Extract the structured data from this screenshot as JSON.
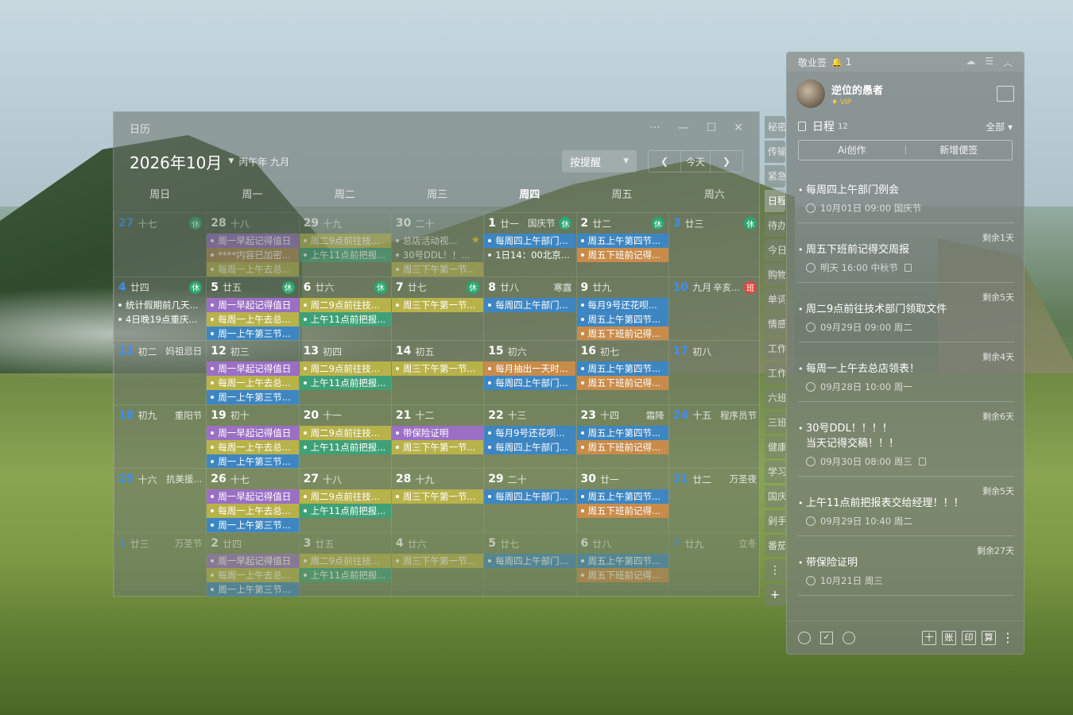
{
  "calendar": {
    "window_title": "日历",
    "month_title": "2026年10月",
    "lunar_title": "丙午年 九月",
    "remind_select": "按提醒",
    "today_label": "今天",
    "weekdays": [
      "周日",
      "周一",
      "周二",
      "周三",
      "周四",
      "周五",
      "周六"
    ],
    "today_weekday_index": 4,
    "colors": {
      "purple": "#9b6fc4",
      "yellow": "#b8b24a",
      "green": "#3fa078",
      "blue": "#3d86c2",
      "orange": "#c98b4a",
      "brown": "#b58a54"
    },
    "weeks": [
      [
        {
          "num": "27",
          "lunar": "十七",
          "out": true,
          "wk": true,
          "badge": "休",
          "events": []
        },
        {
          "num": "28",
          "lunar": "十八",
          "out": true,
          "events": [
            {
              "t": "周一早起记得值日",
              "c": "purple"
            },
            {
              "t": "****内容已加密...",
              "c": "brown"
            },
            {
              "t": "每周一上午去总...",
              "c": "yellow"
            }
          ]
        },
        {
          "num": "29",
          "lunar": "十九",
          "out": true,
          "events": [
            {
              "t": "周二9点前往技...",
              "c": "yellow"
            },
            {
              "t": "上午11点前把报...",
              "c": "green"
            }
          ]
        },
        {
          "num": "30",
          "lunar": "二十",
          "out": true,
          "events": [
            {
              "t": "总店活动视...",
              "c": "plain",
              "star": true
            },
            {
              "t": "30号DDL！！...",
              "c": "plain"
            },
            {
              "t": "周三下午第一节...",
              "c": "yellow"
            }
          ]
        },
        {
          "num": "1",
          "lunar": "廿一",
          "fest": "国庆节",
          "badge": "休",
          "events": [
            {
              "t": "每周四上午部门...",
              "c": "blue"
            },
            {
              "t": "1日14：00北京...",
              "c": "plain"
            }
          ]
        },
        {
          "num": "2",
          "lunar": "廿二",
          "badge": "休",
          "events": [
            {
              "t": "周五上午第四节...",
              "c": "blue"
            },
            {
              "t": "周五下班前记得...",
              "c": "orange"
            }
          ]
        },
        {
          "num": "3",
          "lunar": "廿三",
          "wk": true,
          "badge": "休",
          "events": []
        }
      ],
      [
        {
          "num": "4",
          "lunar": "廿四",
          "wk": true,
          "badge": "休",
          "events": [
            {
              "t": "统计假期前几天...",
              "c": "plain"
            },
            {
              "t": "4日晚19点重庆...",
              "c": "plain"
            }
          ]
        },
        {
          "num": "5",
          "lunar": "廿五",
          "badge": "休",
          "events": [
            {
              "t": "周一早起记得值日",
              "c": "purple"
            },
            {
              "t": "每周一上午去总...",
              "c": "yellow"
            },
            {
              "t": "周一上午第三节...",
              "c": "blue"
            }
          ]
        },
        {
          "num": "6",
          "lunar": "廿六",
          "badge": "休",
          "events": [
            {
              "t": "周二9点前往技...",
              "c": "yellow"
            },
            {
              "t": "上午11点前把报...",
              "c": "green"
            }
          ]
        },
        {
          "num": "7",
          "lunar": "廿七",
          "badge": "休",
          "events": [
            {
              "t": "周三下午第一节...",
              "c": "yellow"
            }
          ]
        },
        {
          "num": "8",
          "lunar": "廿八",
          "fest": "寒露",
          "events": [
            {
              "t": "每周四上午部门...",
              "c": "blue"
            }
          ]
        },
        {
          "num": "9",
          "lunar": "廿九",
          "events": [
            {
              "t": "每月9号还花呗...",
              "c": "blue"
            },
            {
              "t": "周五上午第四节...",
              "c": "blue"
            },
            {
              "t": "周五下班前记得...",
              "c": "orange"
            }
          ]
        },
        {
          "num": "10",
          "lunar": "九月",
          "wk": true,
          "fest": "辛亥...",
          "badge": "班",
          "badgeType": "work",
          "events": []
        }
      ],
      [
        {
          "num": "11",
          "lunar": "初二",
          "wk": true,
          "fest": "妈祖忌日",
          "events": []
        },
        {
          "num": "12",
          "lunar": "初三",
          "events": [
            {
              "t": "周一早起记得值日",
              "c": "purple"
            },
            {
              "t": "每周一上午去总...",
              "c": "yellow"
            },
            {
              "t": "周一上午第三节...",
              "c": "blue"
            }
          ]
        },
        {
          "num": "13",
          "lunar": "初四",
          "events": [
            {
              "t": "周二9点前往技...",
              "c": "yellow"
            },
            {
              "t": "上午11点前把报...",
              "c": "green"
            }
          ]
        },
        {
          "num": "14",
          "lunar": "初五",
          "events": [
            {
              "t": "周三下午第一节...",
              "c": "yellow"
            }
          ]
        },
        {
          "num": "15",
          "lunar": "初六",
          "events": [
            {
              "t": "每月抽出一天时...",
              "c": "orange"
            },
            {
              "t": "每周四上午部门...",
              "c": "blue"
            }
          ]
        },
        {
          "num": "16",
          "lunar": "初七",
          "events": [
            {
              "t": "周五上午第四节...",
              "c": "blue"
            },
            {
              "t": "周五下班前记得...",
              "c": "orange"
            }
          ]
        },
        {
          "num": "17",
          "lunar": "初八",
          "wk": true,
          "events": []
        }
      ],
      [
        {
          "num": "18",
          "lunar": "初九",
          "wk": true,
          "fest": "重阳节",
          "events": []
        },
        {
          "num": "19",
          "lunar": "初十",
          "events": [
            {
              "t": "周一早起记得值日",
              "c": "purple"
            },
            {
              "t": "每周一上午去总...",
              "c": "yellow"
            },
            {
              "t": "周一上午第三节...",
              "c": "blue"
            }
          ]
        },
        {
          "num": "20",
          "lunar": "十一",
          "events": [
            {
              "t": "周二9点前往技...",
              "c": "yellow"
            },
            {
              "t": "上午11点前把报...",
              "c": "green"
            }
          ]
        },
        {
          "num": "21",
          "lunar": "十二",
          "events": [
            {
              "t": "带保险证明",
              "c": "purple"
            },
            {
              "t": "周三下午第一节...",
              "c": "yellow"
            }
          ]
        },
        {
          "num": "22",
          "lunar": "十三",
          "events": [
            {
              "t": "每月9号还花呗...",
              "c": "blue"
            },
            {
              "t": "每周四上午部门...",
              "c": "blue"
            }
          ]
        },
        {
          "num": "23",
          "lunar": "十四",
          "fest": "霜降",
          "events": [
            {
              "t": "周五上午第四节...",
              "c": "blue"
            },
            {
              "t": "周五下班前记得...",
              "c": "orange"
            }
          ]
        },
        {
          "num": "24",
          "lunar": "十五",
          "wk": true,
          "fest": "程序员节",
          "events": []
        }
      ],
      [
        {
          "num": "25",
          "lunar": "十六",
          "wk": true,
          "fest": "抗美援...",
          "events": []
        },
        {
          "num": "26",
          "lunar": "十七",
          "events": [
            {
              "t": "周一早起记得值日",
              "c": "purple"
            },
            {
              "t": "每周一上午去总...",
              "c": "yellow"
            },
            {
              "t": "周一上午第三节...",
              "c": "blue"
            }
          ]
        },
        {
          "num": "27",
          "lunar": "十八",
          "events": [
            {
              "t": "周二9点前往技...",
              "c": "yellow"
            },
            {
              "t": "上午11点前把报...",
              "c": "green"
            }
          ]
        },
        {
          "num": "28",
          "lunar": "十九",
          "events": [
            {
              "t": "周三下午第一节...",
              "c": "yellow"
            }
          ]
        },
        {
          "num": "29",
          "lunar": "二十",
          "events": [
            {
              "t": "每周四上午部门...",
              "c": "blue"
            }
          ]
        },
        {
          "num": "30",
          "lunar": "廿一",
          "events": [
            {
              "t": "周五上午第四节...",
              "c": "blue"
            },
            {
              "t": "周五下班前记得...",
              "c": "orange"
            }
          ]
        },
        {
          "num": "31",
          "lunar": "廿二",
          "wk": true,
          "fest": "万圣夜",
          "events": []
        }
      ],
      [
        {
          "num": "1",
          "lunar": "廿三",
          "out": true,
          "wk": true,
          "fest": "万圣节",
          "events": []
        },
        {
          "num": "2",
          "lunar": "廿四",
          "out": true,
          "events": [
            {
              "t": "周一早起记得值日",
              "c": "purple"
            },
            {
              "t": "每周一上午去总...",
              "c": "yellow"
            },
            {
              "t": "周一上午第三节...",
              "c": "blue"
            }
          ]
        },
        {
          "num": "3",
          "lunar": "廿五",
          "out": true,
          "events": [
            {
              "t": "周二9点前往技...",
              "c": "yellow"
            },
            {
              "t": "上午11点前把报...",
              "c": "green"
            }
          ]
        },
        {
          "num": "4",
          "lunar": "廿六",
          "out": true,
          "events": [
            {
              "t": "周三下午第一节...",
              "c": "yellow"
            }
          ]
        },
        {
          "num": "5",
          "lunar": "廿七",
          "out": true,
          "events": [
            {
              "t": "每周四上午部门...",
              "c": "blue"
            }
          ]
        },
        {
          "num": "6",
          "lunar": "廿八",
          "out": true,
          "events": [
            {
              "t": "周五上午第四节...",
              "c": "blue"
            },
            {
              "t": "周五下班前记得...",
              "c": "orange"
            }
          ]
        },
        {
          "num": "7",
          "lunar": "廿九",
          "out": true,
          "wk": true,
          "fest": "立冬",
          "events": []
        }
      ]
    ]
  },
  "side_tabs": [
    "秘密",
    "传输",
    "紧急",
    "日程",
    "待办",
    "今日",
    "购物",
    "单词",
    "情感",
    "工作",
    "工作",
    "六班",
    "三班",
    "健康",
    "学习",
    "国庆",
    "剁手",
    "番茄"
  ],
  "side_tabs_active": 3,
  "notes": {
    "app_name": "敬业签",
    "notif_count": "1",
    "user_name": "逆位的愚者",
    "vip_label": "VIP",
    "section_title": "日程",
    "section_count": "12",
    "filter": "全部",
    "ai_button": "Ai创作",
    "new_button": "新增便签",
    "items": [
      {
        "remain": "",
        "title": "每周四上午部门例会",
        "meta": "10月01日 09:00 国庆节",
        "lock": false
      },
      {
        "remain": "剩余1天",
        "title": "周五下班前记得交周报",
        "meta": "明天 16:00 中秋节",
        "lock": true
      },
      {
        "remain": "剩余5天",
        "title": "周二9点前往技术部门领取文件",
        "meta": "09月29日 09:00 周二",
        "lock": false
      },
      {
        "remain": "剩余4天",
        "title": "每周一上午去总店领表！",
        "meta": "09月28日 10:00 周一",
        "lock": false
      },
      {
        "remain": "剩余6天",
        "title": "30号DDL！！！！\n当天记得交稿！！！",
        "meta": "09月30日 08:00 周三",
        "lock": true
      },
      {
        "remain": "剩余5天",
        "title": "上午11点前把报表交给经理！！！",
        "meta": "09月29日 10:40 周二",
        "lock": false
      },
      {
        "remain": "剩余27天",
        "title": "带保险证明",
        "meta": "10月21日 周三",
        "lock": false
      }
    ],
    "bottom_icons": [
      "十",
      "账",
      "印",
      "算"
    ]
  }
}
